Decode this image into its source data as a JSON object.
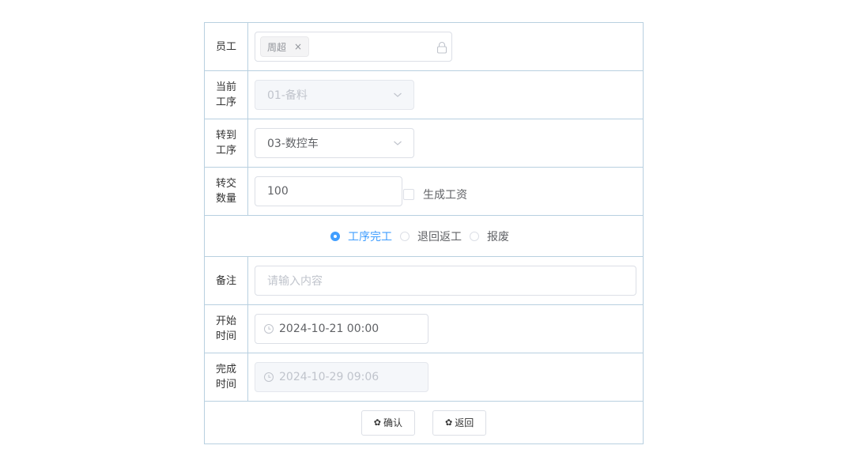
{
  "employee": {
    "label": "员工",
    "tags": [
      "周超"
    ],
    "remove_glyph": "×",
    "icon": "lock-icon"
  },
  "current_step": {
    "label": "当前工序",
    "value": "01-备料"
  },
  "to_step": {
    "label": "转到工序",
    "value": "03-数控车"
  },
  "quantity": {
    "label": "转交数量",
    "value": "100",
    "checkbox_label": "生成工资",
    "checked": false
  },
  "status": {
    "options": [
      "工序完工",
      "退回返工",
      "报废"
    ],
    "selected": "工序完工"
  },
  "remark": {
    "label": "备注",
    "placeholder": "请输入内容"
  },
  "start_time": {
    "label": "开始时间",
    "value": "2024-10-21 00:00"
  },
  "finish_time": {
    "label": "完成时间",
    "value": "2024-10-29 09:06"
  },
  "buttons": {
    "confirm": "确认",
    "back": "返回",
    "icon": "gear-icon"
  },
  "colors": {
    "accent": "#409eff",
    "border": "#b8d0e0",
    "disabled_bg": "#f5f7fa"
  }
}
